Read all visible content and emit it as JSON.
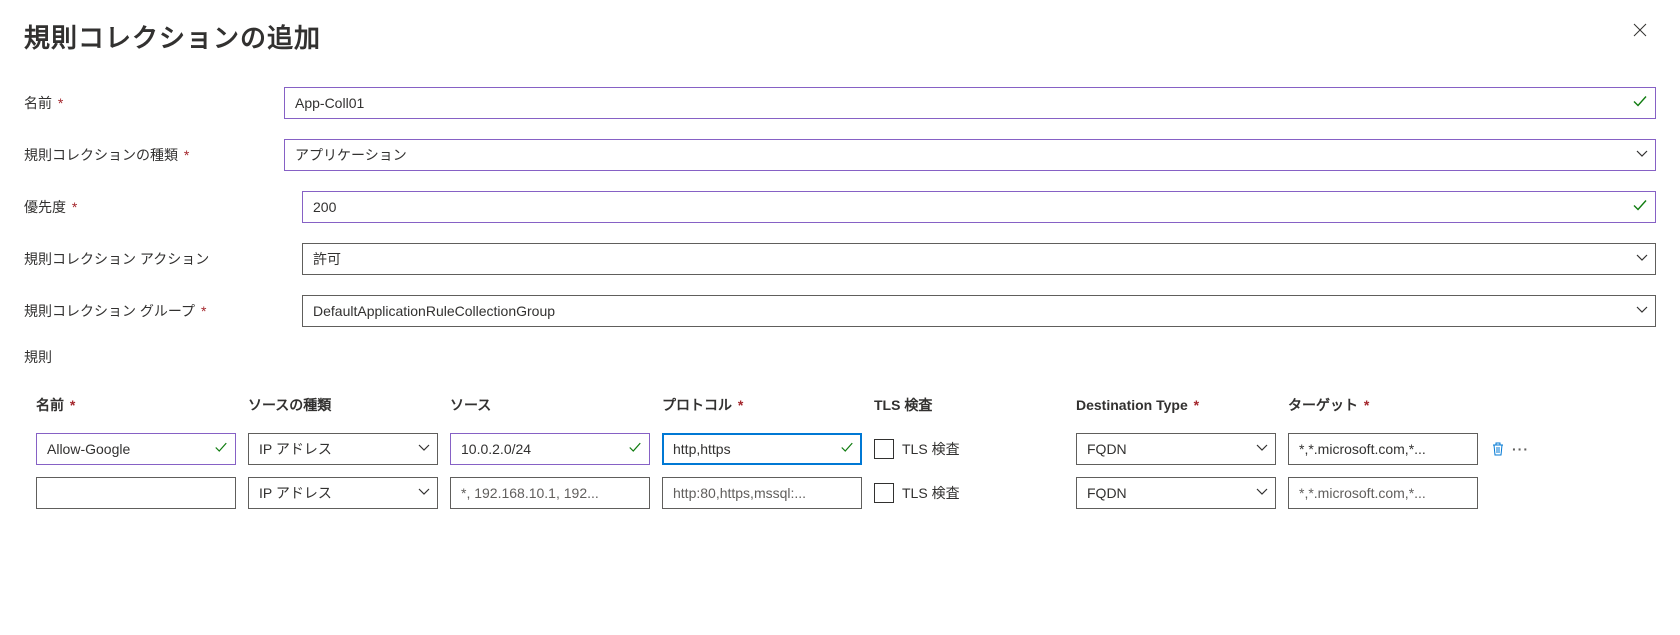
{
  "title": "規則コレクションの追加",
  "labels": {
    "name": "名前",
    "collection_type": "規則コレクションの種類",
    "priority": "優先度",
    "action": "規則コレクション アクション",
    "group": "規則コレクション グループ",
    "rules_section": "規則"
  },
  "fields": {
    "name": "App-Coll01",
    "collection_type": "アプリケーション",
    "priority": "200",
    "action": "許可",
    "group": "DefaultApplicationRuleCollectionGroup"
  },
  "columns": {
    "name": "名前",
    "source_type": "ソースの種類",
    "source": "ソース",
    "protocol": "プロトコル",
    "tls": "TLS 検査",
    "dest_type": "Destination Type",
    "target": "ターゲット"
  },
  "rules": [
    {
      "name": "Allow-Google",
      "source_type": "IP アドレス",
      "source": "10.0.2.0/24",
      "protocol": "http,https",
      "tls_label": "TLS 検査",
      "dest_type": "FQDN",
      "target": "*,*.microsoft.com,*...",
      "name_valid": true,
      "source_valid": true,
      "protocol_focused": true,
      "protocol_valid": true,
      "has_actions": true
    },
    {
      "name": "",
      "source_type": "IP アドレス",
      "source_placeholder": "*, 192.168.10.1, 192...",
      "protocol_placeholder": "http:80,https,mssql:...",
      "tls_label": "TLS 検査",
      "dest_type": "FQDN",
      "target_placeholder": "*,*.microsoft.com,*...",
      "has_actions": false
    }
  ]
}
